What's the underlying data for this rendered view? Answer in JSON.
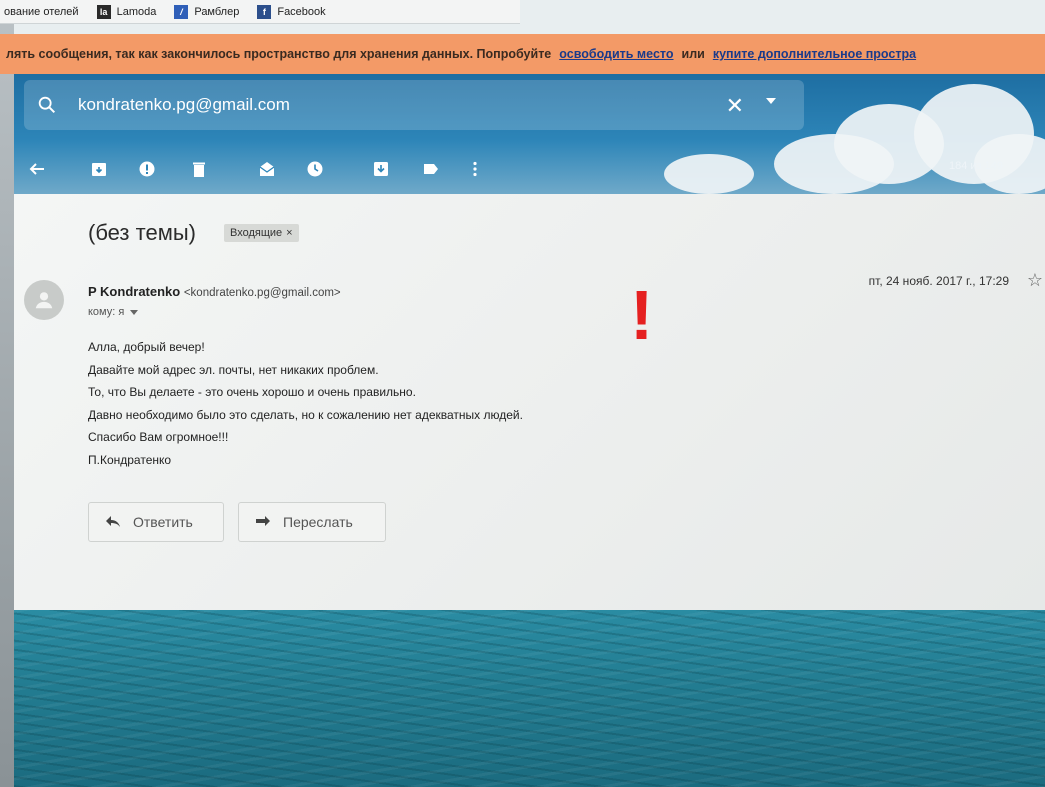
{
  "bookmarks": [
    {
      "label": "ование отелей",
      "icon": ""
    },
    {
      "label": "Lamoda",
      "icon": "lamoda-icon"
    },
    {
      "label": "Рамблер",
      "icon": "rambler-icon"
    },
    {
      "label": "Facebook",
      "icon": "facebook-icon"
    }
  ],
  "banner": {
    "text": "лять сообщения, так как закончилось пространство для хранения данных. Попробуйте",
    "link1": "освободить место",
    "or": "или",
    "link2": "купите дополнительное простра"
  },
  "search": {
    "query": "kondratenko.pg@gmail.com",
    "clear_icon": "close-icon",
    "icon": "search-icon"
  },
  "toolbar": {
    "pager": "184 из 149"
  },
  "email": {
    "subject": "(без темы)",
    "label": "Входящие",
    "label_close": "×",
    "sender_name": "P Kondratenko",
    "sender_email": "<kondratenko.pg@gmail.com>",
    "to": "кому: я",
    "date": "пт, 24 нояб. 2017 г., 17:29",
    "body": [
      "Алла, добрый вечер!",
      "Давайте мой адрес эл. почты, нет никаких проблем.",
      "То, что Вы делаете - это очень хорошо и очень правильно.",
      "Давно необходимо было это сделать, но к сожалению нет адекватных людей.",
      "Спасибо Вам огромное!!!",
      "П.Кондратенко"
    ],
    "annotation": "!",
    "reply_label": "Ответить",
    "forward_label": "Переслать"
  },
  "colors": {
    "banner": "#f39a67",
    "annotation": "#e52020",
    "header": "#2d85b8"
  }
}
